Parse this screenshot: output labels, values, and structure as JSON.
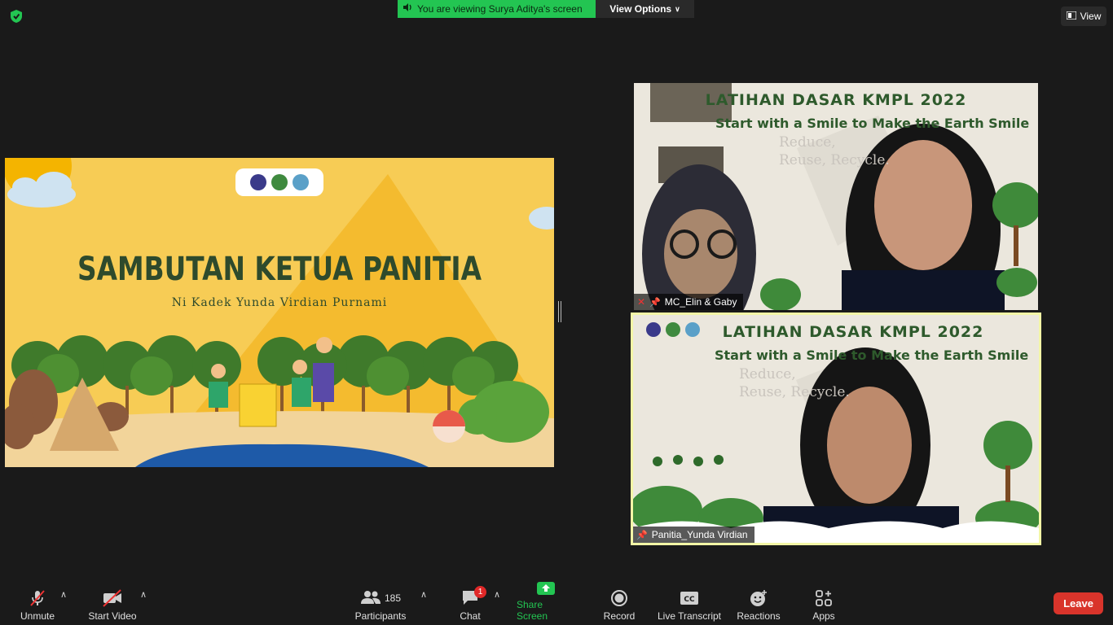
{
  "top_bar": {
    "viewing_text": "You are viewing Surya Aditya's screen",
    "view_options_label": "View Options",
    "view_label": "View"
  },
  "shared_screen": {
    "title": "SAMBUTAN KETUA PANITIA",
    "subtitle": "Ni Kadek Yunda Virdian Purnami"
  },
  "videos": [
    {
      "heading": "LATIHAN DASAR KMPL 2022",
      "tagline": "Start with a Smile to Make the Earth Smile",
      "rrr": [
        "Reduce,",
        "Reuse, Recycle."
      ],
      "name": "MC_Elin & Gaby",
      "muted": true
    },
    {
      "heading": "LATIHAN DASAR KMPL 2022",
      "tagline": "Start with a Smile to Make the Earth Smile",
      "rrr": [
        "Reduce,",
        "Reuse, Recycle."
      ],
      "name": "Panitia_Yunda Virdian",
      "muted": false
    }
  ],
  "toolbar": {
    "unmute": "Unmute",
    "start_video": "Start Video",
    "participants": "Participants",
    "participants_count": "185",
    "chat": "Chat",
    "chat_badge": "1",
    "share_screen": "Share Screen",
    "record": "Record",
    "live_transcript": "Live Transcript",
    "reactions": "Reactions",
    "apps": "Apps",
    "leave": "Leave"
  },
  "colors": {
    "background": "#1a1a1a",
    "accent_green": "#23c552",
    "leave_red": "#d9342b",
    "active_speaker_border": "#f3f7a6"
  }
}
